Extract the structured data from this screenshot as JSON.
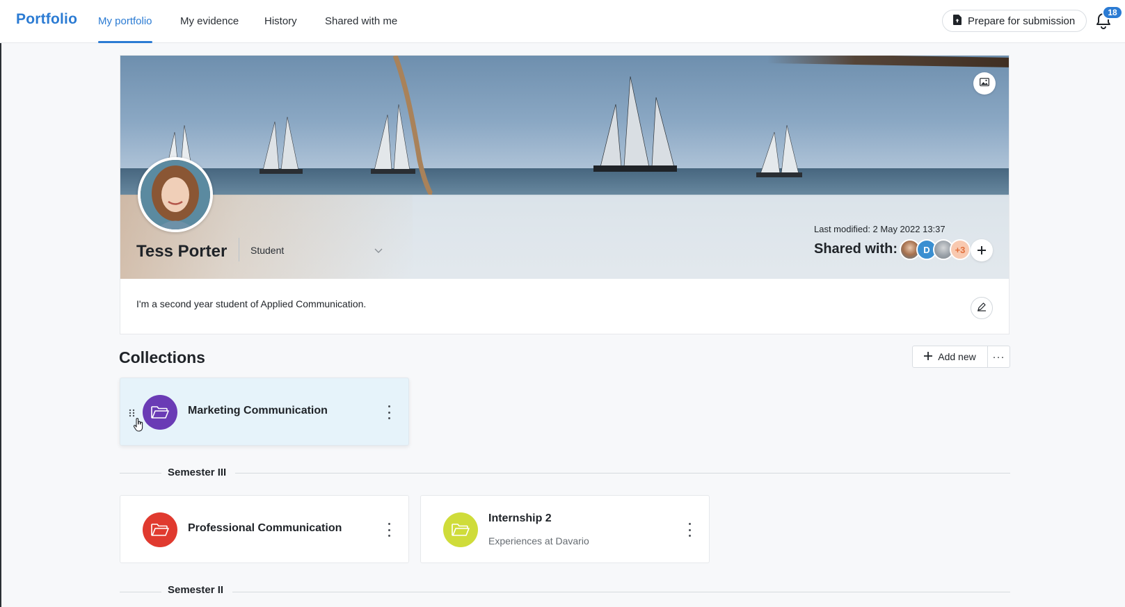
{
  "app": {
    "logo": "Portfolio",
    "accent_color": "#2b7bd3"
  },
  "nav": {
    "tabs": [
      {
        "label": "My portfolio",
        "active": true
      },
      {
        "label": "My evidence",
        "active": false
      },
      {
        "label": "History",
        "active": false
      },
      {
        "label": "Shared with me",
        "active": false
      }
    ],
    "prepare_label": "Prepare for submission",
    "prepare_icon": "file-upload-icon",
    "notifications_icon": "bell-icon",
    "notifications_count": "18"
  },
  "profile": {
    "name": "Tess Porter",
    "role": "Student",
    "last_modified": "Last modified: 2 May 2022 13:37",
    "shared_label": "Shared with:",
    "shared_avatars": [
      {
        "kind": "photo",
        "color": "#8c6a4f"
      },
      {
        "kind": "initial",
        "text": "D",
        "color": "#3a8fd1"
      },
      {
        "kind": "photo",
        "color": "#9aa1a8"
      },
      {
        "kind": "count",
        "text": "+3",
        "color": "#f3a27a"
      }
    ],
    "bio": "I'm a second year student of Applied Communication.",
    "banner_icon": "image-icon",
    "edit_icon": "pencil-icon",
    "add_share_icon": "plus-icon"
  },
  "collections": {
    "title": "Collections",
    "add_label": "Add new",
    "more_label": "···",
    "pinned": [
      {
        "title": "Marketing Communication",
        "subtitle": "",
        "color": "#6a3bb5"
      }
    ],
    "sections": [
      {
        "label": "Semester III",
        "items": [
          {
            "title": "Professional Communication",
            "subtitle": "",
            "color": "#e03a2f"
          },
          {
            "title": "Internship 2",
            "subtitle": "Experiences at Davario",
            "color": "#cfdc3a"
          }
        ]
      },
      {
        "label": "Semester II",
        "items": []
      }
    ]
  }
}
